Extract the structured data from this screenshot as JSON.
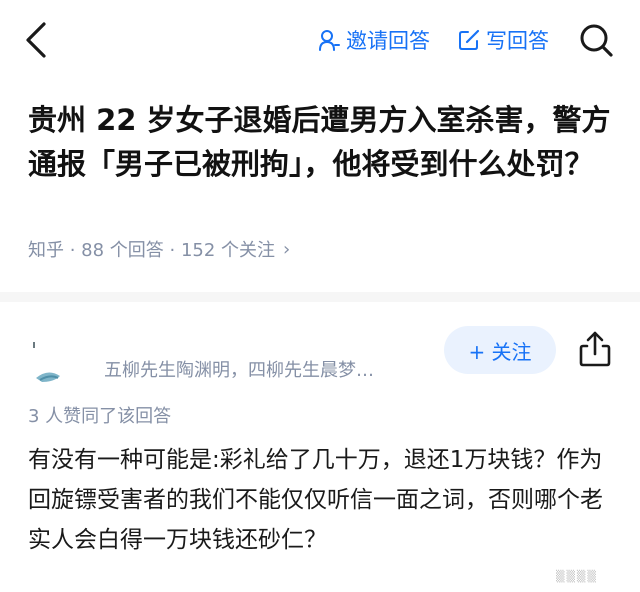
{
  "header": {
    "invite_label": "邀请回答",
    "write_label": "写回答",
    "icons": {
      "back": "back-chevron-icon",
      "invite": "person-icon",
      "write": "edit-icon",
      "search": "search-icon"
    },
    "accent_color": "#1772f6"
  },
  "question": {
    "title": "贵州 22 岁女子退婚后遭男方入室杀害，警方通报「男子已被刑拘」，他将受到什么处罚？",
    "meta": "知乎 · 88 个回答 · 152 个关注",
    "meta_icon": "chevron-right-icon"
  },
  "answer": {
    "author_description": "五柳先生陶渊明，四柳先生晨梦…",
    "follow_label": "+ 关注",
    "votes_text": "3 人赞同了该回答",
    "content": "有没有一种可能是:彩礼给了几十万，退还1万块钱？作为回旋镖受害者的我们不能仅仅听信一面之词，否则哪个老实人会白得一万块钱还砂仁？",
    "share_icon": "share-icon"
  },
  "colors": {
    "meta": "#8590a6",
    "follow_bg": "#eaf2fe",
    "divider": "#f6f6f6"
  }
}
